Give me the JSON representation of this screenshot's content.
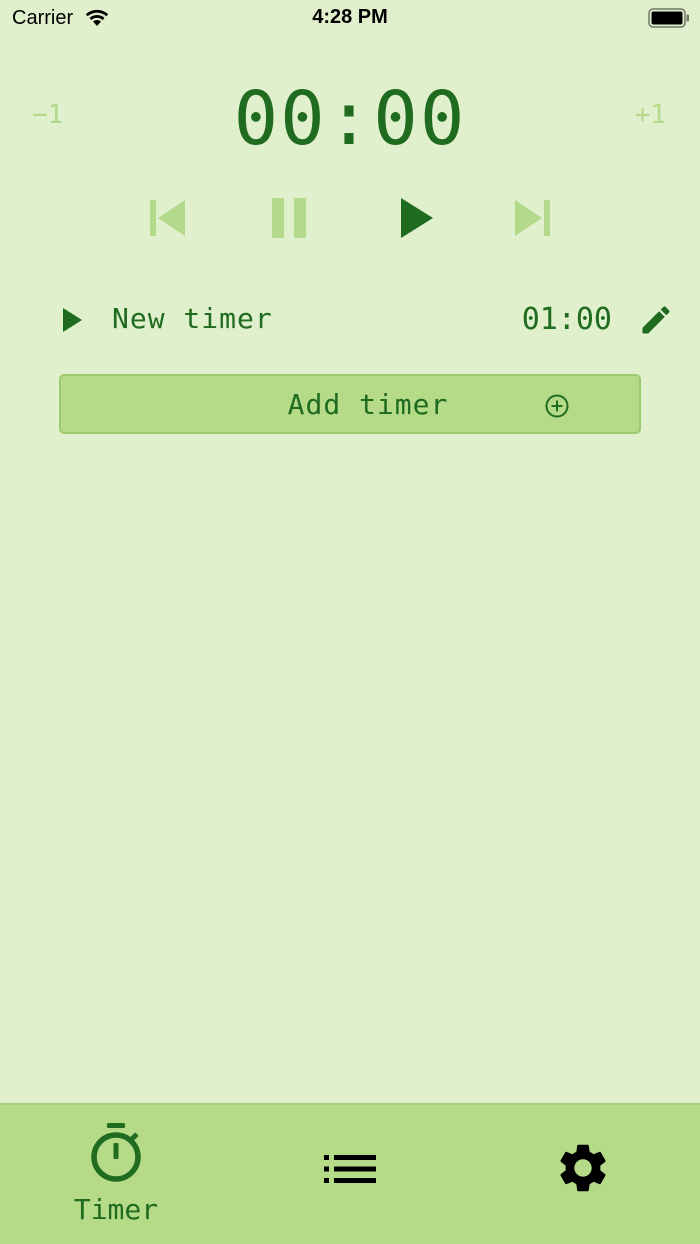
{
  "status_bar": {
    "carrier": "Carrier",
    "time": "4:28 PM"
  },
  "timer_display": {
    "minus_label": "−1",
    "plus_label": "+1",
    "time": "00:00"
  },
  "controls": {
    "previous_icon": "skip-previous-icon",
    "pause_icon": "pause-icon",
    "play_icon": "play-icon",
    "next_icon": "skip-next-icon"
  },
  "timers": [
    {
      "name": "New timer",
      "duration": "01:00"
    }
  ],
  "add_button": {
    "label": "Add timer",
    "icon": "add-circle-icon"
  },
  "tabbar": {
    "tabs": [
      {
        "label": "Timer",
        "icon": "stopwatch-icon",
        "selected": true
      },
      {
        "label": "",
        "icon": "list-icon",
        "selected": false
      },
      {
        "label": "",
        "icon": "gear-icon",
        "selected": false
      }
    ]
  },
  "colors": {
    "background": "#e0efcc",
    "accent": "#1f6b1f",
    "muted": "#b3d98a",
    "button_bg": "#b5db88"
  }
}
